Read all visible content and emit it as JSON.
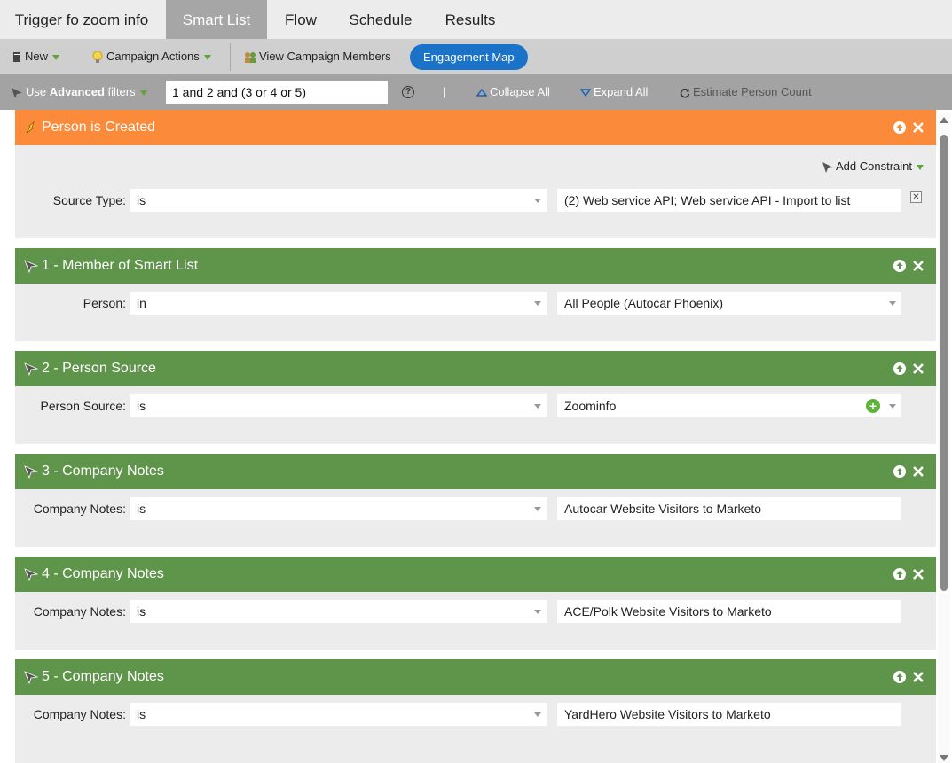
{
  "tabs": [
    {
      "label": "Trigger fo zoom info",
      "active": false
    },
    {
      "label": "Smart List",
      "active": true
    },
    {
      "label": "Flow",
      "active": false
    },
    {
      "label": "Schedule",
      "active": false
    },
    {
      "label": "Results",
      "active": false
    }
  ],
  "toolbar": {
    "new_label": "New",
    "campaign_actions_label": "Campaign Actions",
    "view_members_label": "View Campaign Members",
    "engagement_map_label": "Engagement Map"
  },
  "filterbar": {
    "use_label": "Use",
    "advanced_label": "Advanced",
    "filters_label": "filters",
    "logic_value": "1 and 2 and (3 or 4 or 5)",
    "help_glyph": "?",
    "divider": "|",
    "collapse_all": "Collapse All",
    "expand_all": "Expand All",
    "estimate_count": "Estimate Person Count"
  },
  "trigger": {
    "title": "Person is Created",
    "add_constraint": "Add Constraint",
    "label": "Source Type:",
    "operator": "is",
    "value": "(2) Web service API; Web service API - Import to list"
  },
  "filters": [
    {
      "title": "1 - Member of Smart List",
      "label": "Person:",
      "operator": "in",
      "value": "All People (Autocar Phoenix)"
    },
    {
      "title": "2 - Person Source",
      "label": "Person Source:",
      "operator": "is",
      "value": "Zoominfo"
    },
    {
      "title": "3 - Company Notes",
      "label": "Company Notes:",
      "operator": "is",
      "value": "Autocar Website Visitors to Marketo"
    },
    {
      "title": "4 - Company Notes",
      "label": "Company Notes:",
      "operator": "is",
      "value": "ACE/Polk Website Visitors to Marketo"
    },
    {
      "title": "5 - Company Notes",
      "label": "Company Notes:",
      "operator": "is",
      "value": "YardHero Website Visitors to Marketo"
    }
  ],
  "colors": {
    "trigger_header": "#fb8b3a",
    "filter_header": "#5f944b",
    "accent_button": "#1a73c9"
  }
}
